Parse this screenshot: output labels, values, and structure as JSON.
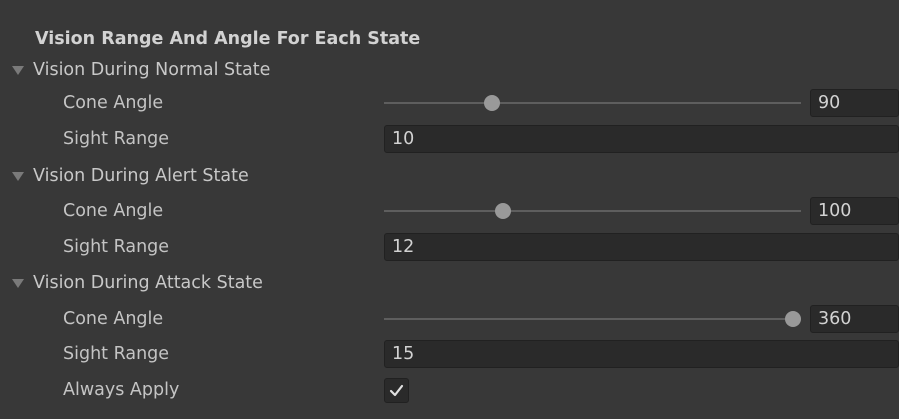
{
  "header": {
    "title": "Vision Range And Angle For Each State"
  },
  "sections": [
    {
      "foldout_label": "Vision During Normal State",
      "cone_angle": {
        "label": "Cone Angle",
        "value": "90",
        "slider_fraction": 0.25
      },
      "sight_range": {
        "label": "Sight Range",
        "value": "10"
      }
    },
    {
      "foldout_label": "Vision During Alert State",
      "cone_angle": {
        "label": "Cone Angle",
        "value": "100",
        "slider_fraction": 0.2778
      },
      "sight_range": {
        "label": "Sight Range",
        "value": "12"
      }
    },
    {
      "foldout_label": "Vision During Attack State",
      "cone_angle": {
        "label": "Cone Angle",
        "value": "360",
        "slider_fraction": 1.0
      },
      "sight_range": {
        "label": "Sight Range",
        "value": "15"
      }
    }
  ],
  "always_apply": {
    "label": "Always Apply",
    "checked": true
  },
  "icons": {
    "foldout": "triangle-down-icon",
    "check": "checkmark-icon"
  },
  "colors": {
    "background": "#383838",
    "field_background": "#2a2a2a",
    "text": "#c4c4c4",
    "slider_thumb": "#999999"
  }
}
